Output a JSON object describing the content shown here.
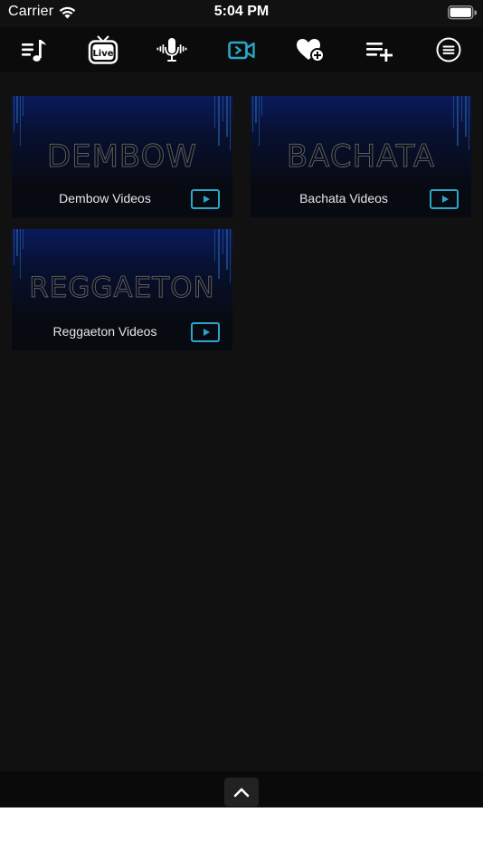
{
  "status_bar": {
    "carrier": "Carrier",
    "time": "5:04 PM"
  },
  "toolbar": {
    "accent_color": "#2aa6c8",
    "items": [
      {
        "icon": "music-list-icon",
        "active": false
      },
      {
        "icon": "live-tv-icon",
        "label": "Live",
        "active": false
      },
      {
        "icon": "podcast-mic-icon",
        "active": false
      },
      {
        "icon": "video-camera-icon",
        "active": true
      },
      {
        "icon": "heart-plus-icon",
        "active": false
      },
      {
        "icon": "playlist-add-icon",
        "active": false
      },
      {
        "icon": "menu-circle-icon",
        "active": false
      }
    ]
  },
  "categories": [
    {
      "art_text": "DEMBOW",
      "title": "Dembow Videos"
    },
    {
      "art_text": "BACHATA",
      "title": "Bachata Videos"
    },
    {
      "art_text": "REGGAETON",
      "title": "Reggaeton Videos"
    }
  ]
}
